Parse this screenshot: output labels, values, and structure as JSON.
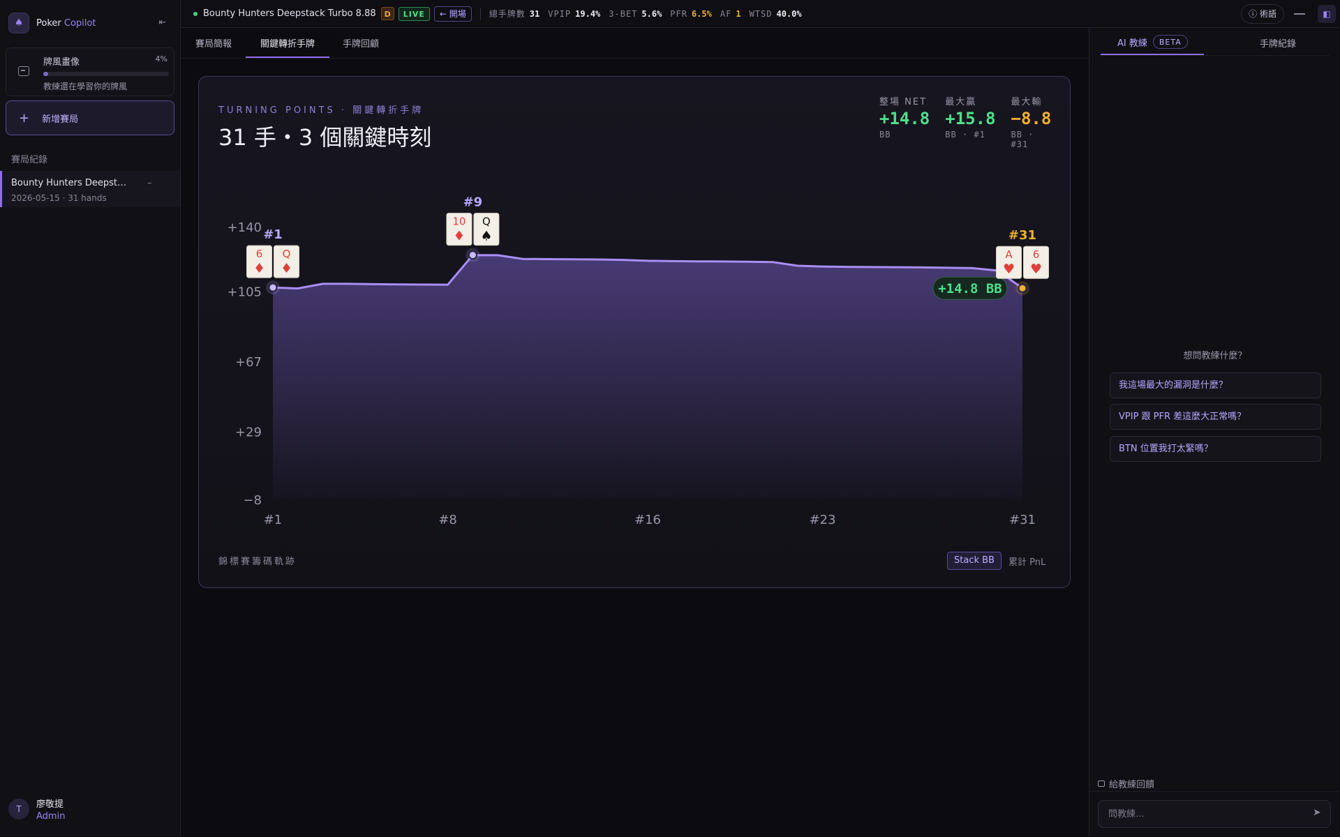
{
  "sidebar": {
    "brand_prefix": "Poker",
    "brand_accent": "Copilot",
    "profile": {
      "title": "牌風畫像",
      "percent_label": "4%",
      "progress": 0.04,
      "subtitle": "教練還在學習你的牌風"
    },
    "new_game_label": "新增賽局",
    "records_title": "賽局紀錄",
    "records": [
      {
        "name": "Bounty Hunters Deepstack Turbo 8.88",
        "date": "2026-05-15",
        "hands": "31 hands"
      }
    ],
    "user": {
      "initial": "T",
      "name": "廖敬提",
      "role": "Admin"
    }
  },
  "topbar": {
    "session_title": "Bounty Hunters Deepstack Turbo 8.88",
    "dealer_badge": "D",
    "live_badge": "LIVE",
    "exit_label": "← 開場",
    "stats": [
      {
        "label": "總手牌數",
        "value": "31"
      },
      {
        "label": "VPIP",
        "value": "19.4%"
      },
      {
        "label": "3-BET",
        "value": "5.6%"
      },
      {
        "label": "PFR",
        "value": "6.5%"
      },
      {
        "label": "AF",
        "value": "1"
      },
      {
        "label": "WTSD",
        "value": "40.0%"
      }
    ],
    "glossary_label": "術語"
  },
  "tabs": [
    "賽局簡報",
    "關鍵轉折手牌",
    "手牌回顧"
  ],
  "active_tab": 1,
  "card": {
    "eyebrow": "TURNING POINTS · 關鍵轉折手牌",
    "headline": "31 手・3 個關鍵時刻",
    "kpis": [
      {
        "label": "整場 NET",
        "value": "+14.8",
        "sub": "BB",
        "tone": "pos"
      },
      {
        "label": "最大贏",
        "value": "+15.8",
        "sub": "BB · #1",
        "tone": "pos"
      },
      {
        "label": "最大輸",
        "value": "−8.8",
        "sub": "BB · #31",
        "tone": "neg"
      }
    ],
    "footer_label": "錦標賽籌碼軌跡",
    "toggle_stack": "Stack BB",
    "toggle_pnl": "累計 PnL"
  },
  "chart_data": {
    "type": "area",
    "ylabel": "",
    "xlabel": "",
    "ylim": [
      -8,
      140
    ],
    "y_ticks": [
      "+140",
      "+105",
      "+67",
      "+29",
      "−8"
    ],
    "y_tick_values": [
      140,
      105,
      67,
      29,
      -8
    ],
    "x_ticks": [
      "#1",
      "#8",
      "#16",
      "#23",
      "#31"
    ],
    "x_tick_values": [
      1,
      8,
      16,
      23,
      31
    ],
    "series": [
      {
        "x": [
          1,
          2,
          3,
          4,
          5,
          6,
          7,
          8,
          9,
          10,
          11,
          12,
          13,
          14,
          15,
          16,
          17,
          18,
          19,
          20,
          21,
          22,
          23,
          24,
          25,
          26,
          27,
          28,
          29,
          30,
          31
        ],
        "values": [
          107,
          106.5,
          109,
          109,
          108.8,
          108.7,
          108.6,
          108.5,
          124.6,
          124.5,
          122.5,
          122.4,
          122.3,
          122.2,
          122,
          121.5,
          121.3,
          121.2,
          121.1,
          121,
          120.8,
          118.8,
          118.4,
          118.2,
          118.1,
          118,
          117.9,
          117.7,
          117.5,
          116.2,
          106.6
        ]
      }
    ],
    "line_color": "#a98ef5",
    "end_label": "+14.8 BB",
    "markers": [
      {
        "label": "#1",
        "hand": 1,
        "color": "#b8a8ff",
        "cards": [
          {
            "rank": "6",
            "suit": "♦",
            "red": true
          },
          {
            "rank": "Q",
            "suit": "♦",
            "red": true
          }
        ]
      },
      {
        "label": "#9",
        "hand": 9,
        "color": "#b8a8ff",
        "cards": [
          {
            "rank": "10",
            "suit": "♦",
            "red": true
          },
          {
            "rank": "Q",
            "suit": "♠",
            "red": false
          }
        ]
      },
      {
        "label": "#31",
        "hand": 31,
        "color": "#f0b030",
        "cards": [
          {
            "rank": "A",
            "suit": "♥",
            "red": true
          },
          {
            "rank": "6",
            "suit": "♥",
            "red": true
          }
        ]
      }
    ]
  },
  "rightpanel": {
    "tab_coach": "AI 教練",
    "beta": "BETA",
    "tab_hands": "手牌紀錄",
    "ask_title": "想問教練什麼？",
    "suggestions": [
      "我這場最大的漏洞是什麼？",
      "VPIP 跟 PFR 差這麼大正常嗎？",
      "BTN 位置我打太緊嗎？"
    ],
    "feedback_label": "給教練回饋",
    "input_placeholder": "問教練..."
  }
}
